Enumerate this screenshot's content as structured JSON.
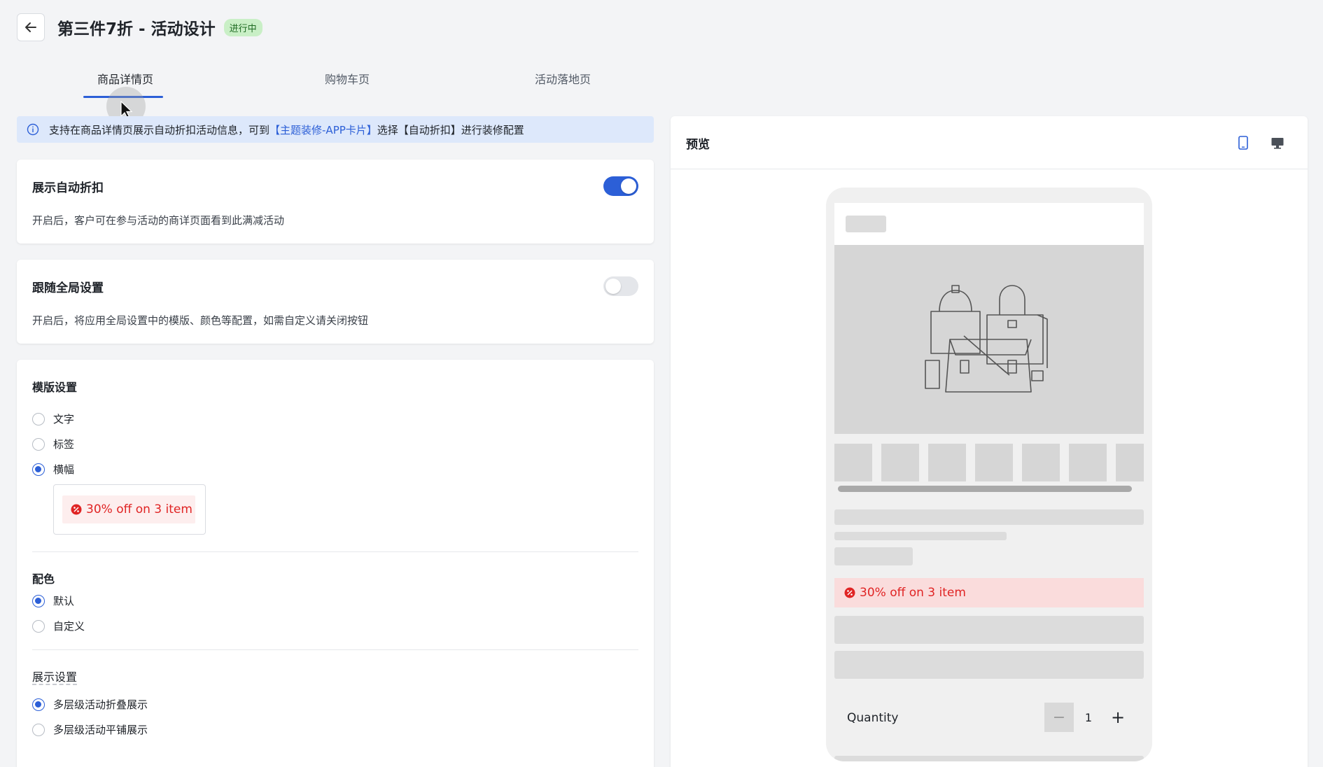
{
  "header": {
    "title": "第三件7折 - 活动设计",
    "status": "进行中"
  },
  "tabs": [
    {
      "label": "商品详情页"
    },
    {
      "label": "购物车页"
    },
    {
      "label": "活动落地页"
    }
  ],
  "info": {
    "prefix": "支持在商品详情页展示自动折扣活动信息，可到",
    "link": "【主题装修-APP卡片】",
    "suffix": "选择【自动折扣】进行装修配置"
  },
  "show_discount": {
    "title": "展示自动折扣",
    "desc": "开启后，客户可在参与活动的商详页面看到此满减活动",
    "enabled": true
  },
  "follow_global": {
    "title": "跟随全局设置",
    "desc": "开启后，将应用全局设置中的模版、颜色等配置，如需自定义请关闭按钮",
    "enabled": false
  },
  "template": {
    "title": "模版设置",
    "options": [
      {
        "label": "文字",
        "checked": false
      },
      {
        "label": "标签",
        "checked": false
      },
      {
        "label": "横幅",
        "checked": true
      }
    ],
    "banner_text": "30% off on 3 item"
  },
  "color": {
    "title": "配色",
    "options": [
      {
        "label": "默认",
        "checked": true
      },
      {
        "label": "自定义",
        "checked": false
      }
    ]
  },
  "display": {
    "title": "展示设置",
    "options": [
      {
        "label": "多层级活动折叠展示",
        "checked": true
      },
      {
        "label": "多层级活动平铺展示",
        "checked": false
      }
    ]
  },
  "preview": {
    "title": "预览",
    "promo_text": "30% off on 3 item",
    "quantity_label": "Quantity",
    "quantity_value": "1",
    "minus": "−",
    "plus": "+"
  },
  "colors": {
    "accent": "#2c5fd7",
    "promo": "#e02424",
    "badge_bg": "#c9efc6"
  }
}
